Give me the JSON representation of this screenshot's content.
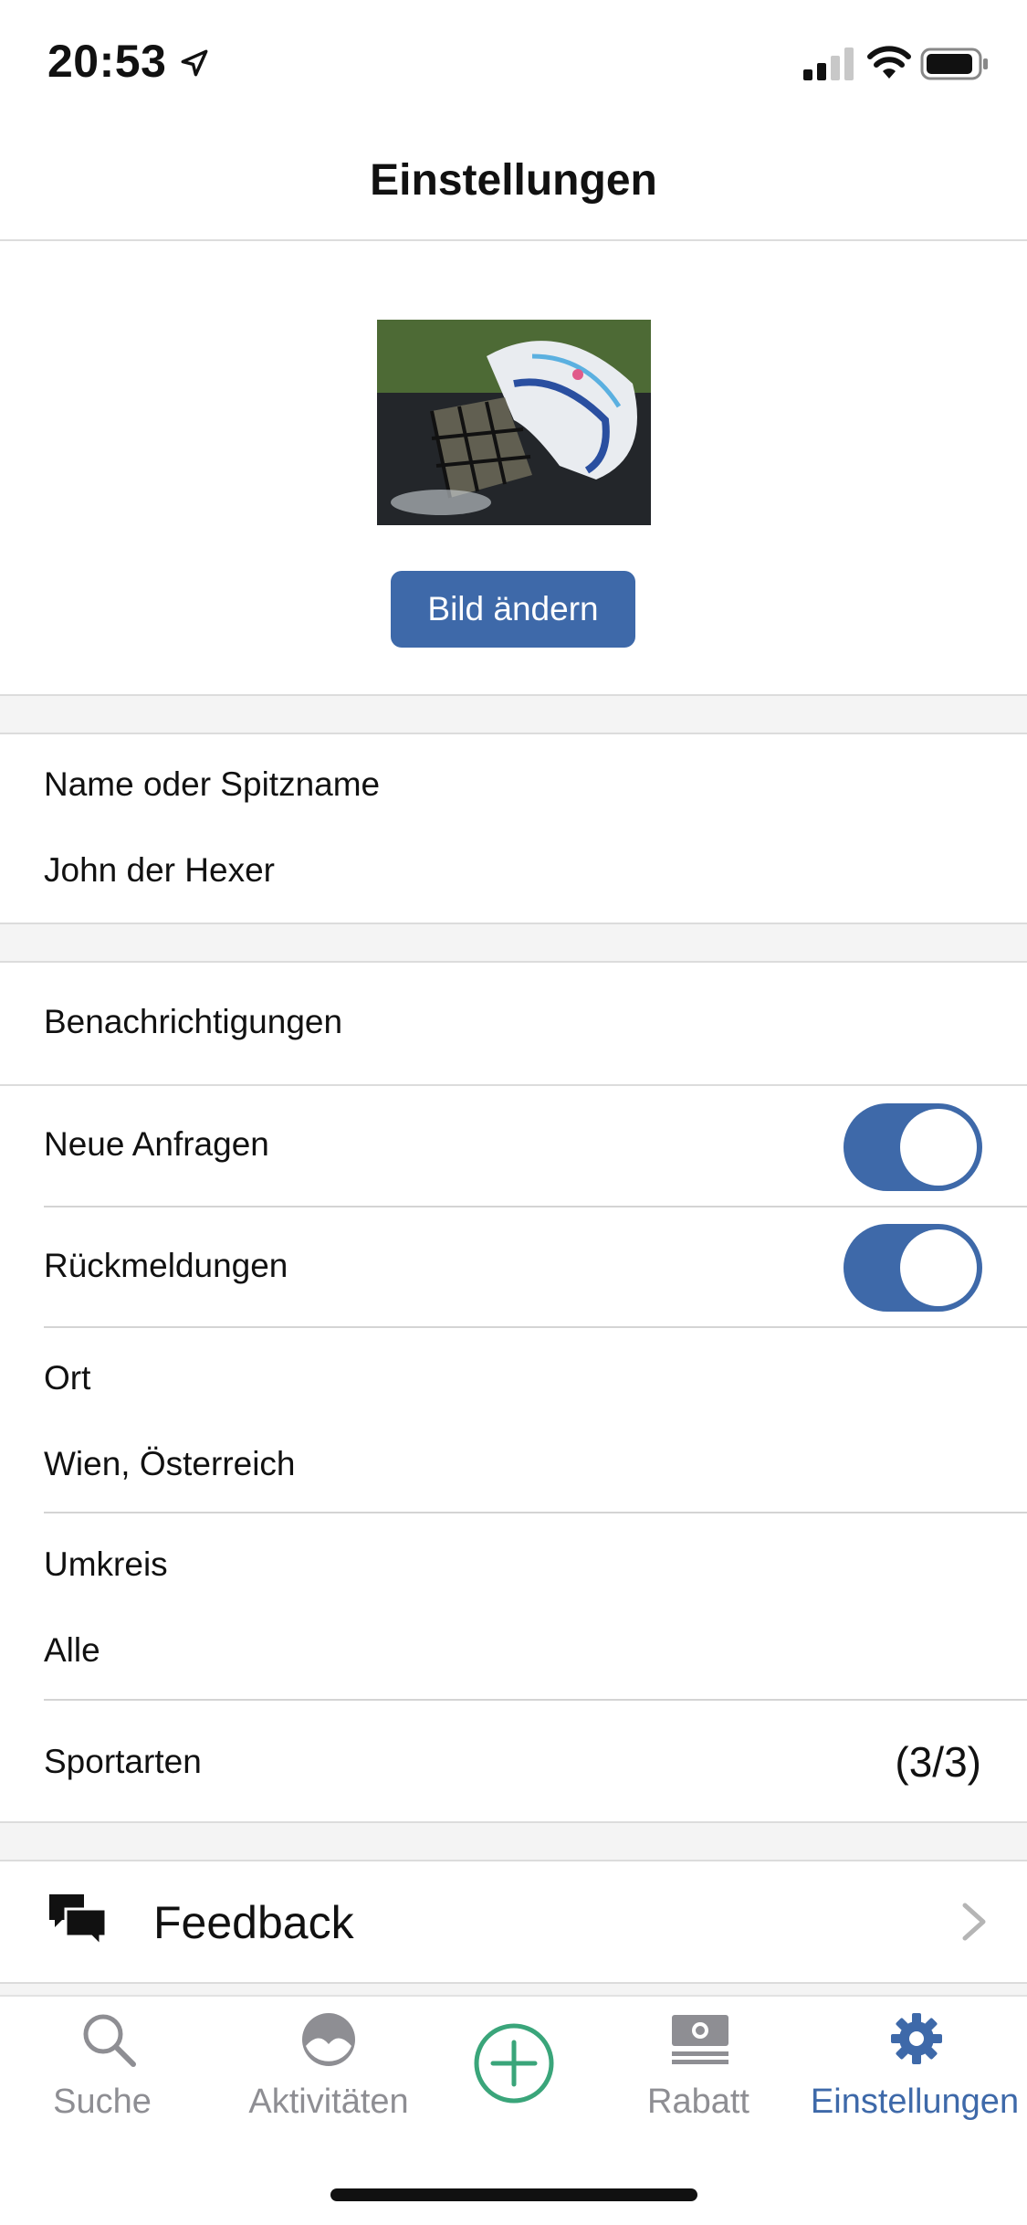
{
  "status_bar": {
    "time": "20:53"
  },
  "header": {
    "title": "Einstellungen"
  },
  "profile": {
    "change_image_label": "Bild ändern"
  },
  "name_section": {
    "label": "Name oder Spitzname",
    "value": "John der Hexer"
  },
  "notifications": {
    "title": "Benachrichtigungen",
    "items": [
      {
        "label": "Neue Anfragen",
        "enabled": true
      },
      {
        "label": "Rückmeldungen",
        "enabled": true
      }
    ]
  },
  "location": {
    "label": "Ort",
    "value": "Wien, Österreich"
  },
  "radius": {
    "label": "Umkreis",
    "value": "Alle"
  },
  "sports": {
    "label": "Sportarten",
    "count": "(3/3)"
  },
  "feedback": {
    "label": "Feedback"
  },
  "tab_bar": {
    "items": [
      {
        "label": "Suche",
        "icon": "search-icon",
        "active": false
      },
      {
        "label": "Aktivitäten",
        "icon": "activities-icon",
        "active": false
      },
      {
        "label": "",
        "icon": "add-circle-icon",
        "active": false
      },
      {
        "label": "Rabatt",
        "icon": "discount-icon",
        "active": false
      },
      {
        "label": "Einstellungen",
        "icon": "gear-icon",
        "active": true
      }
    ]
  },
  "colors": {
    "accent": "#3e69a9",
    "add_button": "#3aa57a",
    "inactive": "#8e8e93"
  }
}
